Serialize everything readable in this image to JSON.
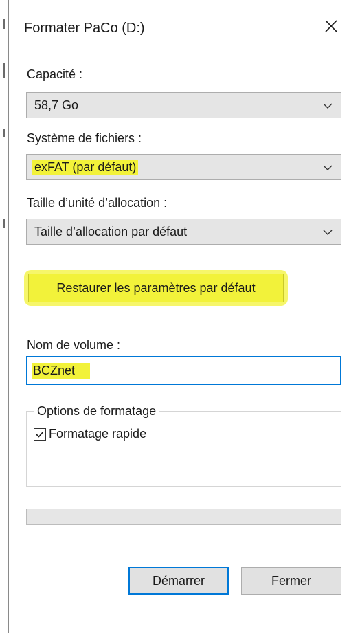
{
  "window": {
    "title": "Formater PaCo (D:)",
    "close_icon": "close-icon"
  },
  "capacity": {
    "label": "Capacité :",
    "value": "58,7 Go"
  },
  "filesystem": {
    "label": "Système de fichiers :",
    "value": "exFAT (par défaut)"
  },
  "allocation": {
    "label": "Taille d’unité d’allocation :",
    "value": "Taille d’allocation par défaut"
  },
  "restore_button": {
    "label": "Restaurer les paramètres par défaut"
  },
  "volume": {
    "label": "Nom de volume :",
    "value": "BCZnet"
  },
  "options": {
    "title": "Options de formatage",
    "quick_format_label": "Formatage rapide",
    "quick_format_checked": true
  },
  "progress": {
    "value": 0
  },
  "footer": {
    "start_label": "Démarrer",
    "close_label": "Fermer"
  },
  "colors": {
    "highlight": "#f2f23a",
    "accent": "#0078d7"
  }
}
